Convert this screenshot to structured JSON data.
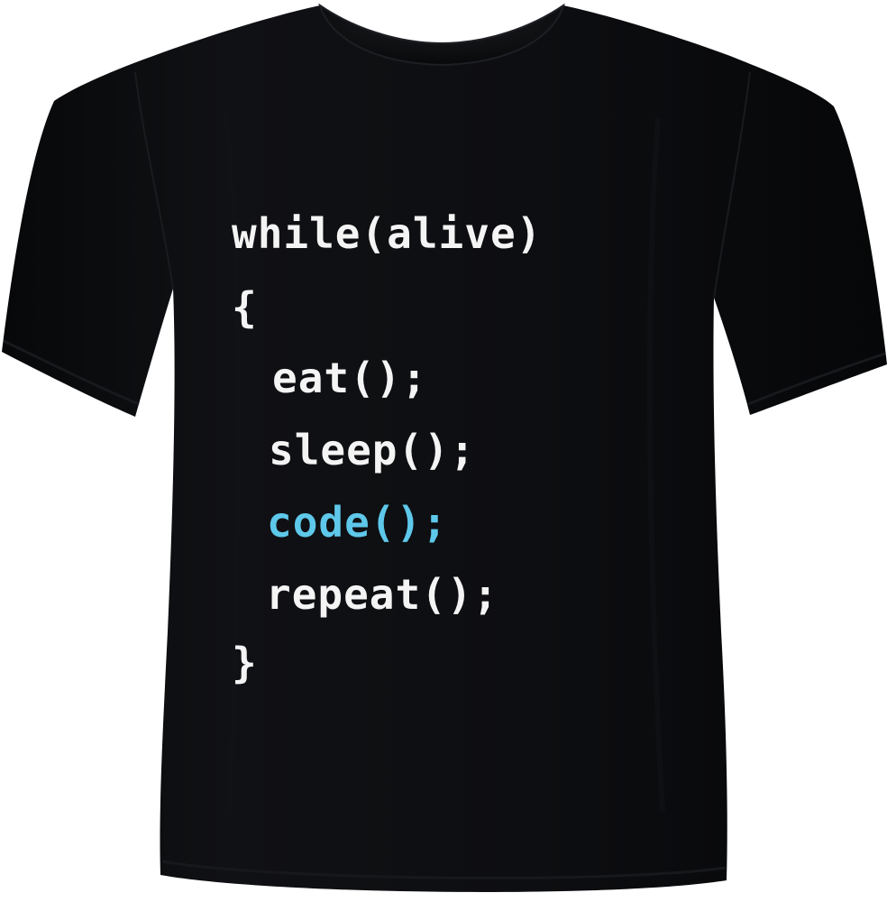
{
  "shirt": {
    "color": "#0c0d0f",
    "print_colors": {
      "text": "#f4f4f4",
      "accent": "#5ec8ea"
    }
  },
  "print": {
    "lines": [
      {
        "text": "while(alive)"
      },
      {
        "text": "{"
      },
      {
        "text": "eat();"
      },
      {
        "text": "sleep();"
      },
      {
        "text": "code();",
        "highlight": true
      },
      {
        "text": "repeat();"
      },
      {
        "text": "}"
      }
    ]
  }
}
